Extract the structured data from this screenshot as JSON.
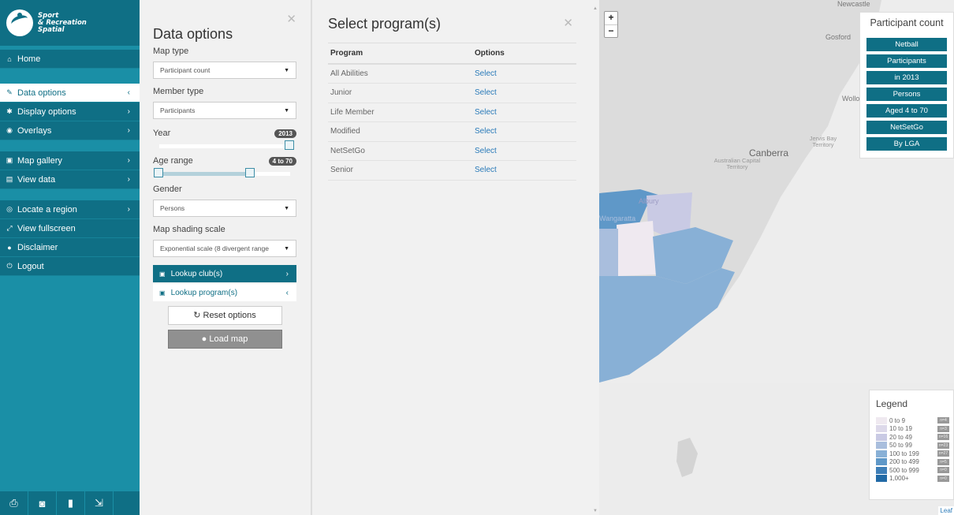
{
  "brand": {
    "line1": "Sport",
    "line2": "& Recreation",
    "line3": "Spatial"
  },
  "nav": {
    "home": "Home",
    "data_options": "Data options",
    "display_options": "Display options",
    "overlays": "Overlays",
    "map_gallery": "Map gallery",
    "view_data": "View data",
    "locate_region": "Locate a region",
    "view_fullscreen": "View fullscreen",
    "disclaimer": "Disclaimer",
    "logout": "Logout"
  },
  "data_panel": {
    "title": "Data options",
    "map_type_label": "Map type",
    "map_type_value": "Participant count",
    "member_type_label": "Member type",
    "member_type_value": "Participants",
    "year_label": "Year",
    "year_value": "2013",
    "age_label": "Age range",
    "age_value": "4 to 70",
    "gender_label": "Gender",
    "gender_value": "Persons",
    "shading_label": "Map shading scale",
    "shading_value": "Exponential scale (8 divergent range",
    "lookup_club": "Lookup club(s)",
    "lookup_program": "Lookup program(s)",
    "reset": "Reset options",
    "load": "Load map"
  },
  "program_panel": {
    "title": "Select program(s)",
    "col_program": "Program",
    "col_options": "Options",
    "rows": [
      {
        "name": "All Abilities",
        "action": "Select"
      },
      {
        "name": "Junior",
        "action": "Select"
      },
      {
        "name": "Life Member",
        "action": "Select"
      },
      {
        "name": "Modified",
        "action": "Select"
      },
      {
        "name": "NetSetGo",
        "action": "Select"
      },
      {
        "name": "Senior",
        "action": "Select"
      }
    ]
  },
  "map": {
    "zoom_in": "+",
    "zoom_out": "−",
    "places": {
      "newcastle": "Newcastle",
      "gosford": "Gosford",
      "wollongong": "Wollo",
      "canberra": "Canberra",
      "act": "Australian Capital Territory",
      "jervis": "Jervis Bay Territory",
      "albury": "Albury",
      "wangaratta": "Wangaratta"
    },
    "info_title": "Participant count",
    "info_tags": [
      "Netball",
      "Participants",
      "in 2013",
      "Persons",
      "Aged 4 to 70",
      "NetSetGo",
      "By LGA"
    ],
    "legend_title": "Legend",
    "legend": [
      {
        "label": "0 to 9",
        "count": "n=4",
        "color": "#efe9f0"
      },
      {
        "label": "10 to 19",
        "count": "n=3",
        "color": "#ddd9ea"
      },
      {
        "label": "20 to 49",
        "count": "n=16",
        "color": "#c9cae4"
      },
      {
        "label": "50 to 99",
        "count": "n=23",
        "color": "#a9bedd"
      },
      {
        "label": "100 to 199",
        "count": "n=27",
        "color": "#88b0d6"
      },
      {
        "label": "200 to 499",
        "count": "n=5",
        "color": "#5f98c8"
      },
      {
        "label": "500 to 999",
        "count": "n=0",
        "color": "#3f7fb8"
      },
      {
        "label": "1,000+",
        "count": "n=0",
        "color": "#226aa6"
      }
    ],
    "attribution": "Leaf"
  }
}
